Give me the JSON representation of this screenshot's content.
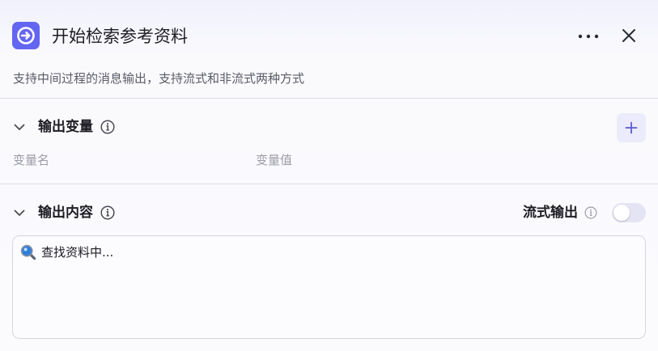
{
  "header": {
    "title": "开始检索参考资料",
    "icon": "arrow-right-circle-icon",
    "accent_color": "#6366f1"
  },
  "description": "支持中间过程的消息输出，支持流式和非流式两种方式",
  "output_variables": {
    "title": "输出变量",
    "columns": [
      "变量名",
      "变量值"
    ]
  },
  "output_content": {
    "title": "输出内容",
    "streaming_label": "流式输出",
    "streaming_enabled": false,
    "text": "查找资料中..."
  }
}
